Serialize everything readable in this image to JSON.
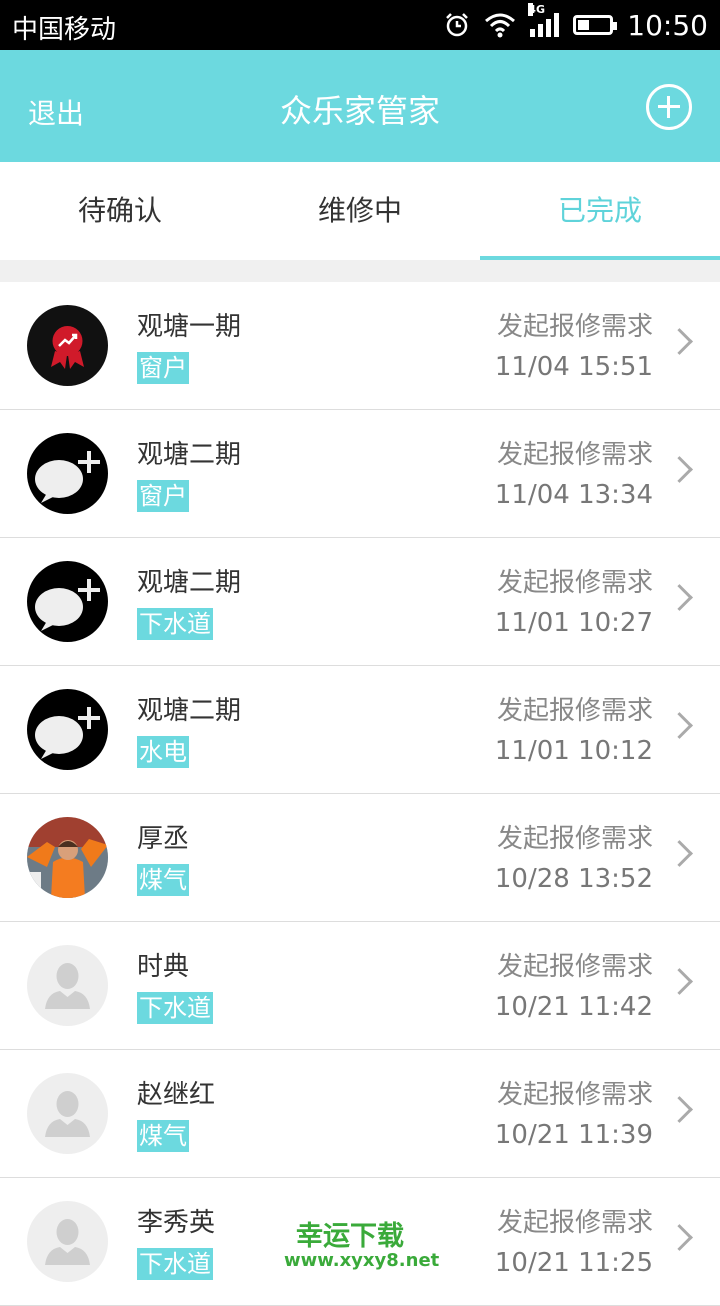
{
  "status_bar": {
    "carrier": "中国移动",
    "network": "4G",
    "time": "10:50",
    "battery_level": 0.35
  },
  "header": {
    "back_label": "退出",
    "title": "众乐家管家",
    "add_icon": "plus-circle-icon"
  },
  "tabs": [
    {
      "label": "待确认",
      "active": false
    },
    {
      "label": "维修中",
      "active": false
    },
    {
      "label": "已完成",
      "active": true
    }
  ],
  "items": [
    {
      "name": "观塘一期",
      "tag": "窗户",
      "status": "发起报修需求",
      "date": "11/04 15:51",
      "avatar": "medal-avatar"
    },
    {
      "name": "观塘二期",
      "tag": "窗户",
      "status": "发起报修需求",
      "date": "11/04 13:34",
      "avatar": "chat-plus-avatar"
    },
    {
      "name": "观塘二期",
      "tag": "下水道",
      "status": "发起报修需求",
      "date": "11/01 10:27",
      "avatar": "chat-plus-avatar"
    },
    {
      "name": "观塘二期",
      "tag": "水电",
      "status": "发起报修需求",
      "date": "11/01 10:12",
      "avatar": "chat-plus-avatar"
    },
    {
      "name": "厚丞",
      "tag": "煤气",
      "status": "发起报修需求",
      "date": "10/28 13:52",
      "avatar": "photo-avatar"
    },
    {
      "name": "时典",
      "tag": "下水道",
      "status": "发起报修需求",
      "date": "10/21 11:42",
      "avatar": "default-user-avatar"
    },
    {
      "name": "赵继红",
      "tag": "煤气",
      "status": "发起报修需求",
      "date": "10/21 11:39",
      "avatar": "default-user-avatar"
    },
    {
      "name": "李秀英",
      "tag": "下水道",
      "status": "发起报修需求",
      "date": "10/21 11:25",
      "avatar": "default-user-avatar"
    }
  ],
  "watermark": {
    "line1": "幸运下载",
    "line2": "www.xyxy8.net"
  },
  "colors": {
    "accent": "#6cd9df",
    "status_bar": "#000000"
  }
}
